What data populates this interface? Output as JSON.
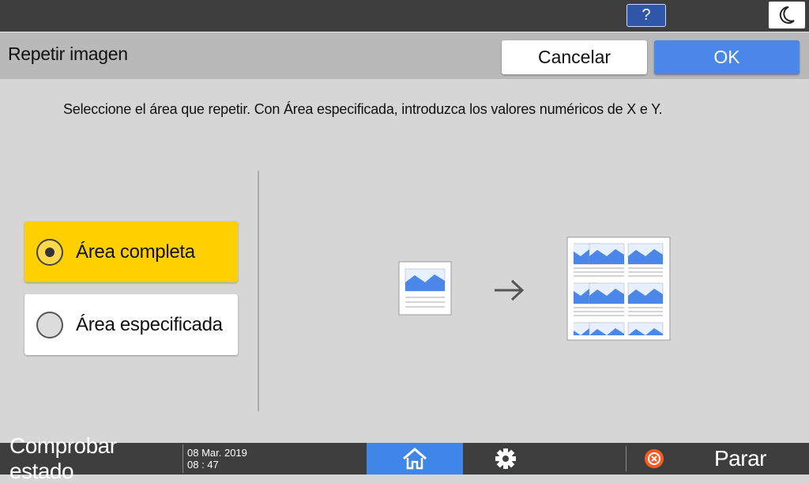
{
  "topbar": {
    "help_label": "?",
    "energy_icon": "moon-icon"
  },
  "header": {
    "title": "Repetir imagen",
    "cancel_label": "Cancelar",
    "ok_label": "OK"
  },
  "instruction": "Seleccione el área que repetir. Con Área especificada, introduzca los valores numéricos de X e Y.",
  "options": [
    {
      "label": "Área completa",
      "selected": true
    },
    {
      "label": "Área especificada",
      "selected": false
    }
  ],
  "footer": {
    "check_status_label": "Comprobar estado",
    "date": "08 Mar. 2019",
    "time": "08 : 47",
    "home_icon": "home-icon",
    "settings_icon": "gear-icon",
    "stop_label": "Parar"
  },
  "colors": {
    "accent": "#4a87e8",
    "selected": "#ffd000",
    "bar": "#3e3e3e",
    "header": "#b9b9b9"
  }
}
